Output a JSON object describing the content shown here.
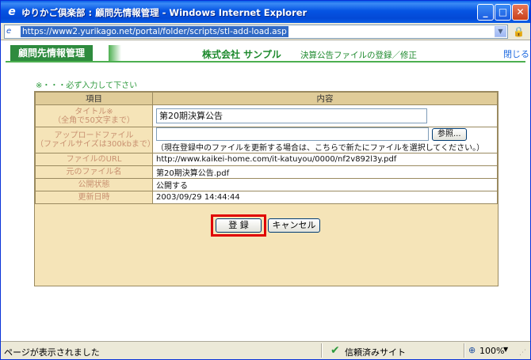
{
  "window": {
    "title": "ゆりかご倶楽部 : 顧問先情報管理 - Windows Internet Explorer",
    "address": "https://www2.yurikago.net/portal/folder/scripts/stl-add-load.asp"
  },
  "header": {
    "badge": "顧問先情報管理",
    "company": "株式会社 サンプル",
    "subtitle": "決算公告ファイルの登録／修正",
    "close_label": "閉じる"
  },
  "form": {
    "required_note": "※・・・必ず入力して下さい",
    "columns": {
      "item": "項目",
      "content": "内容"
    },
    "title_label_1": "タイトル※",
    "title_label_2": "（全角で50文字まで）",
    "title_value": "第20期決算公告",
    "upload_label_1": "アップロードファイル",
    "upload_label_2": "（ファイルサイズは300kbまで）",
    "browse_label": "参照...",
    "upload_note": "（現在登録中のファイルを更新する場合は、こちらで新たにファイルを選択してください。）",
    "rows": [
      {
        "label": "ファイルのURL",
        "value": "http://www.kaikei-home.com/it-katuyou/0000/nf2v892l3y.pdf"
      },
      {
        "label": "元のファイル名",
        "value": "第20期決算公告.pdf"
      },
      {
        "label": "公開状態",
        "value": "公開する"
      },
      {
        "label": "更新日時",
        "value": "2003/09/29 14:44:44"
      }
    ],
    "submit_label": "登 録",
    "cancel_label": "キャンセル"
  },
  "status": {
    "text": "ページが表示されました",
    "trust": "信頼済みサイト",
    "zoom": "100%"
  }
}
